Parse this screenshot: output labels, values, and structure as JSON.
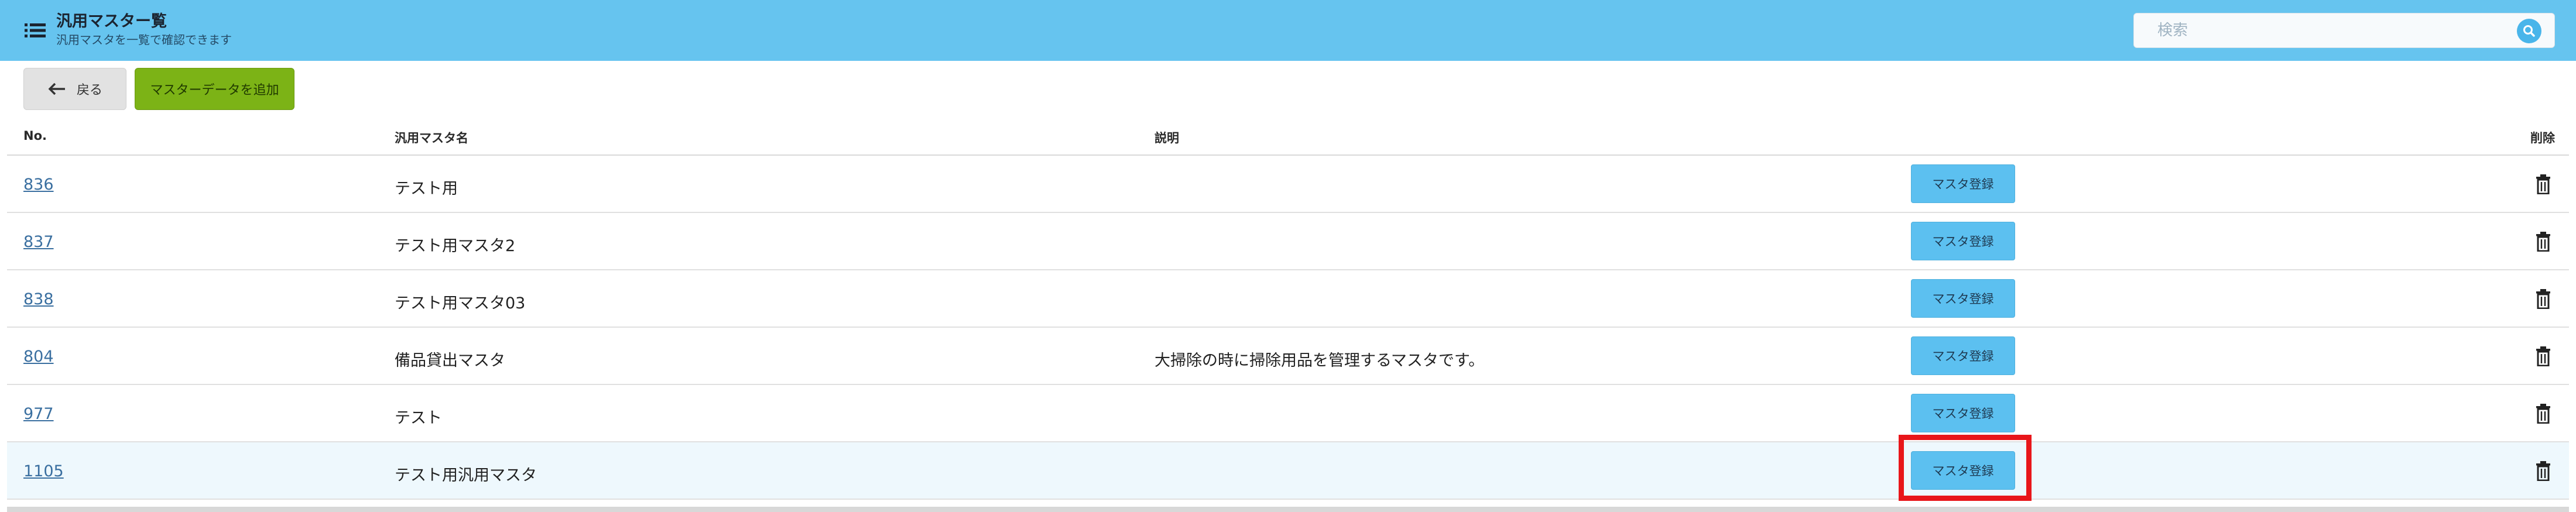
{
  "header": {
    "title": "汎用マスター覧",
    "subtitle": "汎用マスタを一覧で確認できます",
    "search_placeholder": "検索"
  },
  "toolbar": {
    "back_label": "戻る",
    "add_label": "マスターデータを追加"
  },
  "table": {
    "columns": {
      "no": "No.",
      "name": "汎用マスタ名",
      "desc": "説明",
      "delete": "削除"
    },
    "rows": [
      {
        "no": "836",
        "name": "テスト用",
        "desc": "",
        "action": "マスタ登録"
      },
      {
        "no": "837",
        "name": "テスト用マスタ2",
        "desc": "",
        "action": "マスタ登録"
      },
      {
        "no": "838",
        "name": "テスト用マスタ03",
        "desc": "",
        "action": "マスタ登録"
      },
      {
        "no": "804",
        "name": "備品貸出マスタ",
        "desc": "大掃除の時に掃除用品を管理するマスタです。",
        "action": "マスタ登録"
      },
      {
        "no": "977",
        "name": "テスト",
        "desc": "",
        "action": "マスタ登録"
      },
      {
        "no": "1105",
        "name": "テスト用汎用マスタ",
        "desc": "",
        "action": "マスタ登録"
      }
    ]
  },
  "colors": {
    "header_bg": "#66c4ef",
    "add_button": "#7cb316",
    "register_button": "#5cc0f0",
    "highlight": "#e8161a"
  }
}
